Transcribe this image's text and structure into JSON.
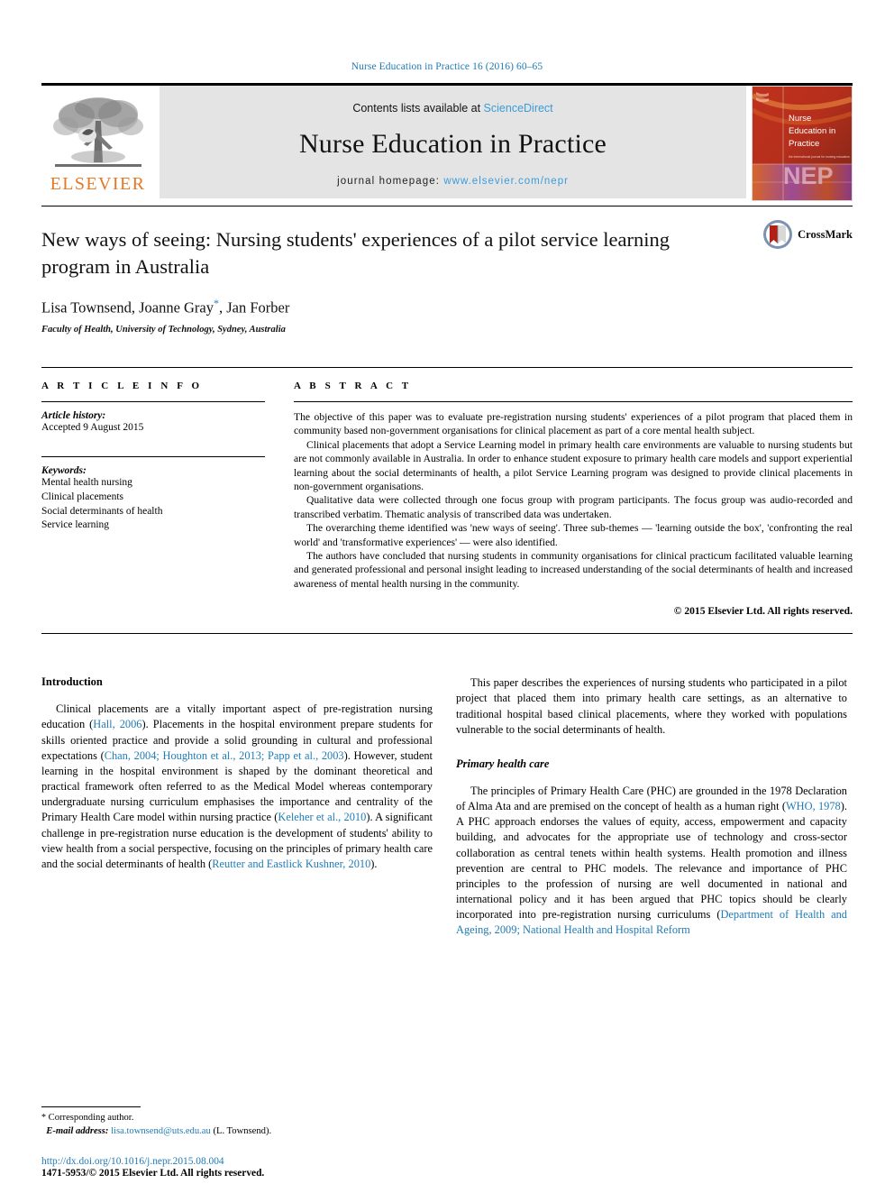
{
  "running_head": "Nurse Education in Practice 16 (2016) 60–65",
  "banner": {
    "contents_prefix": "Contents lists available at ",
    "sciencedirect": "ScienceDirect",
    "journal_name": "Nurse Education in Practice",
    "homepage_prefix": "journal homepage: ",
    "homepage_url": "www.elsevier.com/nepr",
    "publisher_logo_text": "ELSEVIER",
    "cover_title_line1": "Nurse",
    "cover_title_line2": "Education in",
    "cover_title_line3": "Practice",
    "cover_acronym": "NEP"
  },
  "article": {
    "title": "New ways of seeing: Nursing students' experiences of a pilot service learning program in Australia",
    "authors": "Lisa Townsend, Joanne Gray",
    "authors_tail": ", Jan Forber",
    "corresponding_marker": "*",
    "affiliation": "Faculty of Health, University of Technology, Sydney, Australia",
    "crossmark_label": "CrossMark"
  },
  "article_info": {
    "heading": "A R T I C L E  I N F O",
    "history_label": "Article history:",
    "history_value": "Accepted 9 August 2015",
    "keywords_label": "Keywords:",
    "keywords": [
      "Mental health nursing",
      "Clinical placements",
      "Social determinants of health",
      "Service learning"
    ]
  },
  "abstract": {
    "heading": "A B S T R A C T",
    "paragraphs": [
      "The objective of this paper was to evaluate pre-registration nursing students' experiences of a pilot program that placed them in community based non-government organisations for clinical placement as part of a core mental health subject.",
      "Clinical placements that adopt a Service Learning model in primary health care environments are valuable to nursing students but are not commonly available in Australia. In order to enhance student exposure to primary health care models and support experiential learning about the social determinants of health, a pilot Service Learning program was designed to provide clinical placements in non-government organisations.",
      "Qualitative data were collected through one focus group with program participants. The focus group was audio-recorded and transcribed verbatim. Thematic analysis of transcribed data was undertaken.",
      "The overarching theme identified was 'new ways of seeing'. Three sub-themes — 'learning outside the box', 'confronting the real world' and 'transformative experiences' — were also identified.",
      "The authors have concluded that nursing students in community organisations for clinical practicum facilitated valuable learning and generated professional and personal insight leading to increased understanding of the social determinants of health and increased awareness of mental health nursing in the community."
    ],
    "copyright": "© 2015 Elsevier Ltd. All rights reserved."
  },
  "body": {
    "left_heading": "Introduction",
    "left_paragraphs": [
      {
        "segments": [
          {
            "t": "Clinical placements are a vitally important aspect of pre-registration nursing education (",
            "link": false
          },
          {
            "t": "Hall, 2006",
            "link": true
          },
          {
            "t": "). Placements in the hospital environment prepare students for skills oriented practice and provide a solid grounding in cultural and professional expectations (",
            "link": false
          },
          {
            "t": "Chan, 2004; Houghton et al., 2013; Papp et al., 2003",
            "link": true
          },
          {
            "t": "). However, student learning in the hospital environment is shaped by the dominant theoretical and practical framework often referred to as the Medical Model whereas contemporary undergraduate nursing curriculum emphasises the importance and centrality of the Primary Health Care model within nursing practice (",
            "link": false
          },
          {
            "t": "Keleher et al., 2010",
            "link": true
          },
          {
            "t": "). A significant challenge in pre-registration nurse education is the development of students' ability to view health from a social perspective, focusing on the principles of primary health care and the social determinants of health (",
            "link": false
          },
          {
            "t": "Reutter and Eastlick Kushner, 2010",
            "link": true
          },
          {
            "t": ").",
            "link": false
          }
        ]
      }
    ],
    "right_paragraphs_top": [
      {
        "segments": [
          {
            "t": "This paper describes the experiences of nursing students who participated in a pilot project that placed them into primary health care settings, as an alternative to traditional hospital based clinical placements, where they worked with populations vulnerable to the social determinants of health.",
            "link": false
          }
        ]
      }
    ],
    "right_subheading": "Primary health care",
    "right_paragraphs_bottom": [
      {
        "segments": [
          {
            "t": "The principles of Primary Health Care (PHC) are grounded in the 1978 Declaration of Alma Ata and are premised on the concept of health as a human right (",
            "link": false
          },
          {
            "t": "WHO, 1978",
            "link": true
          },
          {
            "t": "). A PHC approach endorses the values of equity, access, empowerment and capacity building, and advocates for the appropriate use of technology and cross-sector collaboration as central tenets within health systems. Health promotion and illness prevention are central to PHC models. The relevance and importance of PHC principles to the profession of nursing are well documented in national and international policy and it has been argued that PHC topics should be clearly incorporated into pre-registration nursing curriculums (",
            "link": false
          },
          {
            "t": "Department of Health and Ageing, 2009; National Health and Hospital Reform",
            "link": true
          }
        ]
      }
    ]
  },
  "footnote": {
    "corresponding_star": "*",
    "corresponding_text": "Corresponding author.",
    "email_label": "E-mail address:",
    "email": "lisa.townsend@uts.edu.au",
    "email_owner": "(L. Townsend).",
    "doi": "http://dx.doi.org/10.1016/j.nepr.2015.08.004",
    "issn_line": "1471-5953/© 2015 Elsevier Ltd. All rights reserved."
  },
  "colors": {
    "link_blue": "#1f7bb6",
    "sciencedirect_blue": "#3b9cd9",
    "elsevier_orange": "#e87722",
    "cover_red": "#b8321f"
  }
}
